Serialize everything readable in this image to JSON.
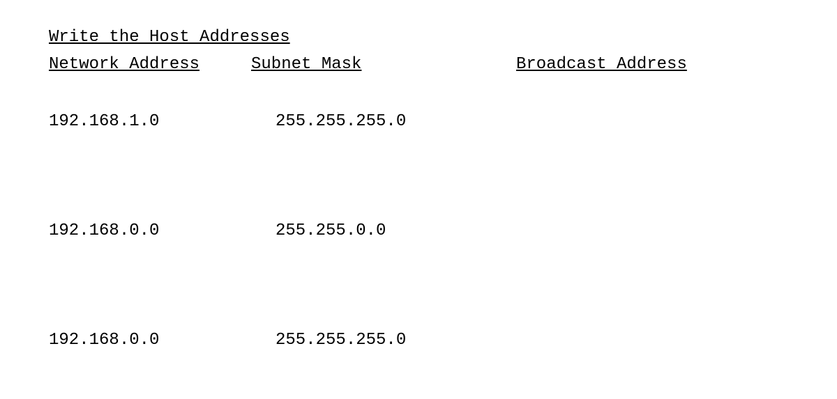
{
  "title": "Write the Host Addresses",
  "headers": {
    "col1": "Network Address",
    "col2": "Subnet Mask",
    "col3": "Broadcast Address"
  },
  "rows": [
    {
      "network": "192.168.1.0",
      "mask": "255.255.255.0",
      "broadcast": ""
    },
    {
      "network": "192.168.0.0",
      "mask": "255.255.0.0",
      "broadcast": ""
    },
    {
      "network": "192.168.0.0",
      "mask": "255.255.255.0",
      "broadcast": ""
    }
  ]
}
